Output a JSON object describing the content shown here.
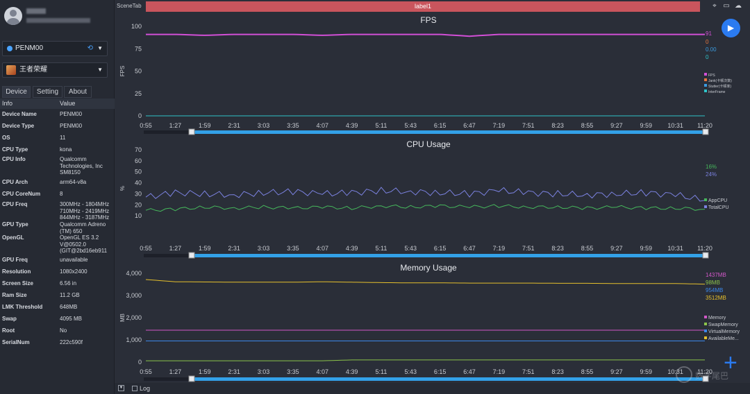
{
  "user": {},
  "device_selector": {
    "value": "PENM00"
  },
  "game_selector": {
    "value": "王者荣耀"
  },
  "tabs": [
    "Device",
    "Setting",
    "About"
  ],
  "info_table": {
    "headers": [
      "Info",
      "Value"
    ],
    "rows": [
      {
        "k": "Device Name",
        "v": "PENM00"
      },
      {
        "k": "Device Type",
        "v": "PENM00"
      },
      {
        "k": "OS",
        "v": "11"
      },
      {
        "k": "CPU Type",
        "v": "kona"
      },
      {
        "k": "CPU Info",
        "v": "Qualcomm Technologies, Inc SM8150"
      },
      {
        "k": "CPU Arch",
        "v": "arm64-v8a"
      },
      {
        "k": "CPU CoreNum",
        "v": "8"
      },
      {
        "k": "CPU Freq",
        "v": "300MHz - 1804MHz 710MHz - 2419MHz 844MHz - 3187MHz"
      },
      {
        "k": "GPU Type",
        "v": "Qualcomm Adreno (TM) 650"
      },
      {
        "k": "OpenGL",
        "v": "OpenGL ES 3.2 V@0502.0 (GIT@2bd16eb911"
      },
      {
        "k": "GPU Freq",
        "v": "unavailable"
      },
      {
        "k": "Resolution",
        "v": "1080x2400"
      },
      {
        "k": "Screen Size",
        "v": "6.56 in"
      },
      {
        "k": "Ram Size",
        "v": "11.2 GB"
      },
      {
        "k": "LMK Threshold",
        "v": "648MB"
      },
      {
        "k": "Swap",
        "v": "4095 MB"
      },
      {
        "k": "Root",
        "v": "No"
      },
      {
        "k": "SerialNum",
        "v": "222c590f"
      }
    ]
  },
  "scene_tab": "SceneTab",
  "label_bar": "label1",
  "log": {
    "label": "Log"
  },
  "watermark": "数字尾巴",
  "colors": {
    "fps": "#d24fd6",
    "jank": "#e7763c",
    "stutter": "#3b9bdf",
    "interframe": "#2ec4c9",
    "appcpu": "#46b85c",
    "totalcpu": "#7b82e0",
    "memory": "#d158c8",
    "swap": "#8bc34a",
    "virtual": "#3b88ea",
    "available": "#e6c02c",
    "accent": "#2b7bf0",
    "label_bar": "#c9555d"
  },
  "chart_data": [
    {
      "type": "line",
      "title": "FPS",
      "ylabel": "FPS",
      "ylim": [
        0,
        100
      ],
      "yticks": [
        "0",
        "25",
        "50",
        "75",
        "100"
      ],
      "x_ticks": [
        "0:55",
        "1:27",
        "1:59",
        "2:31",
        "3:03",
        "3:35",
        "4:07",
        "4:39",
        "5:11",
        "5:43",
        "6:15",
        "6:47",
        "7:19",
        "7:51",
        "8:23",
        "8:55",
        "9:27",
        "9:59",
        "10:31",
        "11:20"
      ],
      "current_values": [
        "91",
        "0",
        "0.00",
        "0"
      ],
      "legend": [
        "FPS",
        "Jank(卡顿次数)",
        "Stutter(卡顿率)",
        "InterFrame"
      ],
      "series": [
        {
          "name": "FPS",
          "color": "fps",
          "values": [
            91,
            91,
            90,
            91,
            91,
            91,
            90,
            91,
            91,
            91,
            91,
            89,
            91,
            91,
            91,
            91,
            91,
            91,
            91,
            91
          ]
        },
        {
          "name": "InterFrame",
          "color": "interframe",
          "values": [
            0,
            0,
            0,
            0,
            0,
            0,
            0,
            0,
            0,
            0,
            0,
            0,
            0,
            0,
            0,
            0,
            0,
            0,
            0,
            0
          ]
        }
      ]
    },
    {
      "type": "line",
      "title": "CPU Usage",
      "ylabel": "%",
      "ylim": [
        0,
        70
      ],
      "yticks": [
        "10",
        "20",
        "30",
        "40",
        "50",
        "60",
        "70"
      ],
      "x_ticks": [
        "0:55",
        "1:27",
        "1:59",
        "2:31",
        "3:03",
        "3:35",
        "4:07",
        "4:39",
        "5:11",
        "5:43",
        "6:15",
        "6:47",
        "7:19",
        "7:51",
        "8:23",
        "8:55",
        "9:27",
        "9:59",
        "10:31",
        "11:20"
      ],
      "current_values": [
        "16%",
        "24%"
      ],
      "legend": [
        "AppCPU",
        "TotalCPU"
      ],
      "series": [
        {
          "name": "AppCPU",
          "color": "appcpu",
          "values": [
            15,
            16,
            18,
            17,
            18,
            17,
            18,
            17,
            19,
            18,
            19,
            18,
            19,
            18,
            18,
            17,
            18,
            17,
            17,
            16
          ]
        },
        {
          "name": "TotalCPU",
          "color": "totalcpu",
          "values": [
            27,
            31,
            30,
            29,
            31,
            32,
            30,
            31,
            33,
            32,
            31,
            30,
            33,
            31,
            30,
            29,
            30,
            31,
            29,
            24
          ]
        }
      ]
    },
    {
      "type": "line",
      "title": "Memory Usage",
      "ylabel": "MB",
      "ylim": [
        0,
        4000
      ],
      "yticks": [
        "0",
        "1,000",
        "2,000",
        "3,000",
        "4,000"
      ],
      "x_ticks": [
        "0:55",
        "1:27",
        "1:59",
        "2:31",
        "3:03",
        "3:35",
        "4:07",
        "4:39",
        "5:11",
        "5:43",
        "6:15",
        "6:47",
        "7:19",
        "7:51",
        "8:23",
        "8:55",
        "9:27",
        "9:59",
        "10:31",
        "11:20"
      ],
      "current_values": [
        "1437MB",
        "98MB",
        "954MB",
        "3512MB"
      ],
      "legend": [
        "Memory",
        "SwapMemory",
        "VirtualMemory",
        "AvailableMe..."
      ],
      "series": [
        {
          "name": "Memory",
          "color": "memory",
          "values": [
            1437,
            1437,
            1437,
            1437,
            1437,
            1437,
            1437,
            1437,
            1437,
            1437,
            1437,
            1437,
            1437,
            1437,
            1437,
            1437,
            1437,
            1437,
            1437,
            1437
          ]
        },
        {
          "name": "SwapMemory",
          "color": "swap",
          "values": [
            60,
            60,
            60,
            60,
            60,
            60,
            60,
            98,
            98,
            98,
            98,
            98,
            98,
            98,
            98,
            98,
            98,
            98,
            98,
            98
          ]
        },
        {
          "name": "VirtualMemory",
          "color": "virtual",
          "values": [
            954,
            954,
            954,
            954,
            954,
            954,
            954,
            954,
            954,
            954,
            954,
            954,
            954,
            954,
            954,
            954,
            954,
            954,
            954,
            954
          ]
        },
        {
          "name": "AvailableMemory",
          "color": "available",
          "values": [
            3720,
            3620,
            3610,
            3600,
            3600,
            3600,
            3620,
            3600,
            3580,
            3570,
            3570,
            3560,
            3560,
            3560,
            3550,
            3550,
            3540,
            3540,
            3540,
            3512
          ]
        }
      ]
    }
  ]
}
